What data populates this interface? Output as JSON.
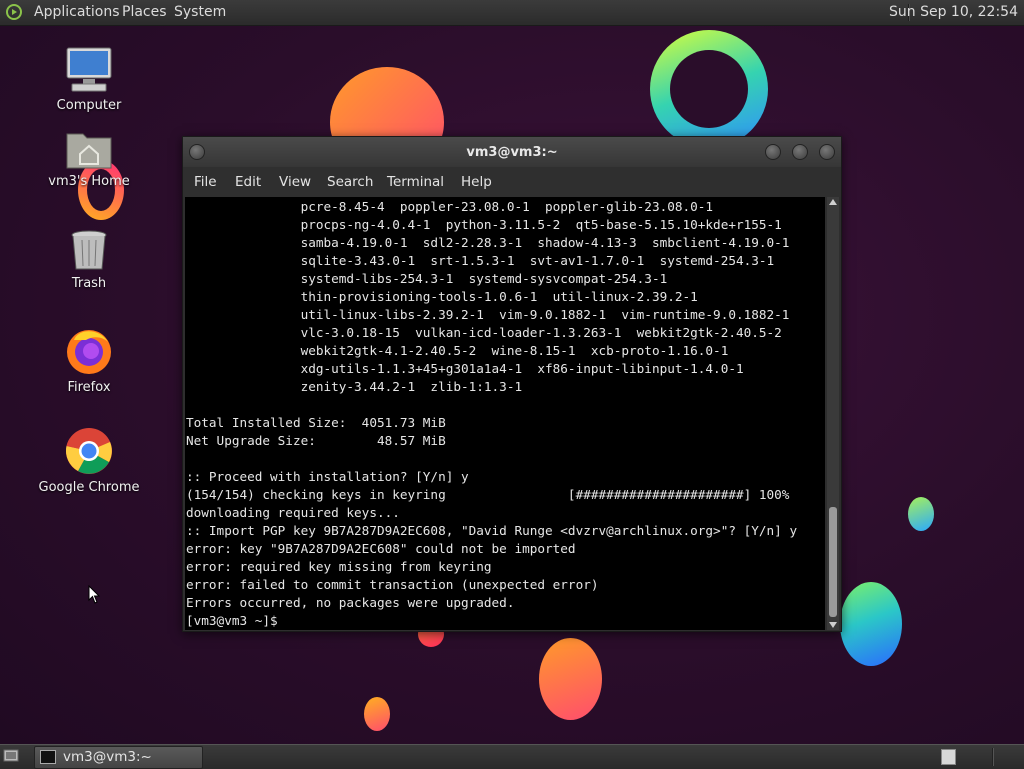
{
  "top_panel": {
    "menus": [
      "Applications",
      "Places",
      "System"
    ],
    "clock": "Sun Sep 10, 22:54"
  },
  "desktop": {
    "icons": [
      {
        "label": "Computer",
        "icon": "computer-icon"
      },
      {
        "label": "vm3's Home",
        "icon": "home-folder-icon"
      },
      {
        "label": "Trash",
        "icon": "trash-icon"
      },
      {
        "label": "Firefox",
        "icon": "firefox-icon"
      },
      {
        "label": "Google Chrome",
        "icon": "chrome-icon"
      }
    ]
  },
  "terminal": {
    "title": "vm3@vm3:~",
    "menu": [
      "File",
      "Edit",
      "View",
      "Search",
      "Terminal",
      "Help"
    ],
    "lines": [
      "               pcre-8.45-4  poppler-23.08.0-1  poppler-glib-23.08.0-1",
      "               procps-ng-4.0.4-1  python-3.11.5-2  qt5-base-5.15.10+kde+r155-1",
      "               samba-4.19.0-1  sdl2-2.28.3-1  shadow-4.13-3  smbclient-4.19.0-1",
      "               sqlite-3.43.0-1  srt-1.5.3-1  svt-av1-1.7.0-1  systemd-254.3-1",
      "               systemd-libs-254.3-1  systemd-sysvcompat-254.3-1",
      "               thin-provisioning-tools-1.0.6-1  util-linux-2.39.2-1",
      "               util-linux-libs-2.39.2-1  vim-9.0.1882-1  vim-runtime-9.0.1882-1",
      "               vlc-3.0.18-15  vulkan-icd-loader-1.3.263-1  webkit2gtk-2.40.5-2",
      "               webkit2gtk-4.1-2.40.5-2  wine-8.15-1  xcb-proto-1.16.0-1",
      "               xdg-utils-1.1.3+45+g301a1a4-1  xf86-input-libinput-1.4.0-1",
      "               zenity-3.44.2-1  zlib-1:1.3-1",
      "",
      "Total Installed Size:  4051.73 MiB",
      "Net Upgrade Size:        48.57 MiB",
      "",
      ":: Proceed with installation? [Y/n] y",
      "(154/154) checking keys in keyring                [######################] 100%",
      "downloading required keys...",
      ":: Import PGP key 9B7A287D9A2EC608, \"David Runge <dvzrv@archlinux.org>\"? [Y/n] y",
      "error: key \"9B7A287D9A2EC608\" could not be imported",
      "error: required key missing from keyring",
      "error: failed to commit transaction (unexpected error)",
      "Errors occurred, no packages were upgraded.",
      "[vm3@vm3 ~]$ "
    ]
  },
  "bottom_panel": {
    "task_label": "vm3@vm3:~"
  }
}
